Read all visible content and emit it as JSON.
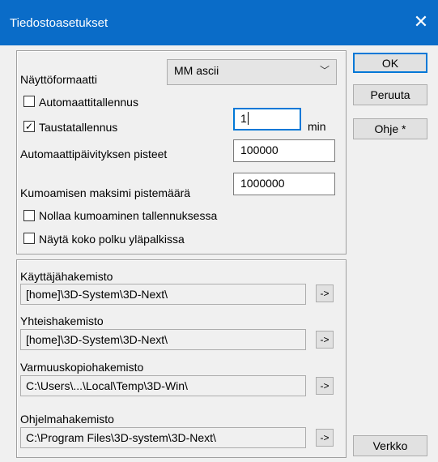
{
  "window": {
    "title": "Tiedostoasetukset",
    "close_icon": "close-icon"
  },
  "settings": {
    "display_format_label": "Näyttöformaatti",
    "display_format_value": "MM ascii",
    "autosave_label": "Automaattitallennus",
    "autosave_checked": false,
    "background_save_label": "Taustatallennus",
    "background_save_checked": true,
    "background_save_value": "1",
    "background_save_unit": "min",
    "auto_update_points_label": "Automaattipäivityksen pisteet",
    "auto_update_points_value": "100000",
    "undo_max_points_label": "Kumoamisen maksimi pistemäärä",
    "undo_max_points_value": "1000000",
    "reset_undo_on_save_label": "Nollaa kumoaminen tallennuksessa",
    "reset_undo_on_save_checked": false,
    "show_full_path_label": "Näytä koko polku yläpalkissa",
    "show_full_path_checked": false
  },
  "directories": [
    {
      "label": "Käyttäjähakemisto",
      "path": "[home]\\3D-System\\3D-Next\\",
      "button": "->"
    },
    {
      "label": "Yhteishakemisto",
      "path": "[home]\\3D-System\\3D-Next\\",
      "button": "->"
    },
    {
      "label": "Varmuuskopiohakemisto",
      "path": "C:\\Users\\...\\Local\\Temp\\3D-Win\\",
      "button": "->"
    },
    {
      "label": "Ohjelmahakemisto",
      "path": "C:\\Program Files\\3D-system\\3D-Next\\",
      "button": "->"
    }
  ],
  "buttons": {
    "ok": "OK",
    "cancel": "Peruuta",
    "help": "Ohje *",
    "network": "Verkko"
  },
  "colors": {
    "titlebar": "#0a6cc8",
    "focus": "#0078d7",
    "background": "#f0f0f0"
  }
}
